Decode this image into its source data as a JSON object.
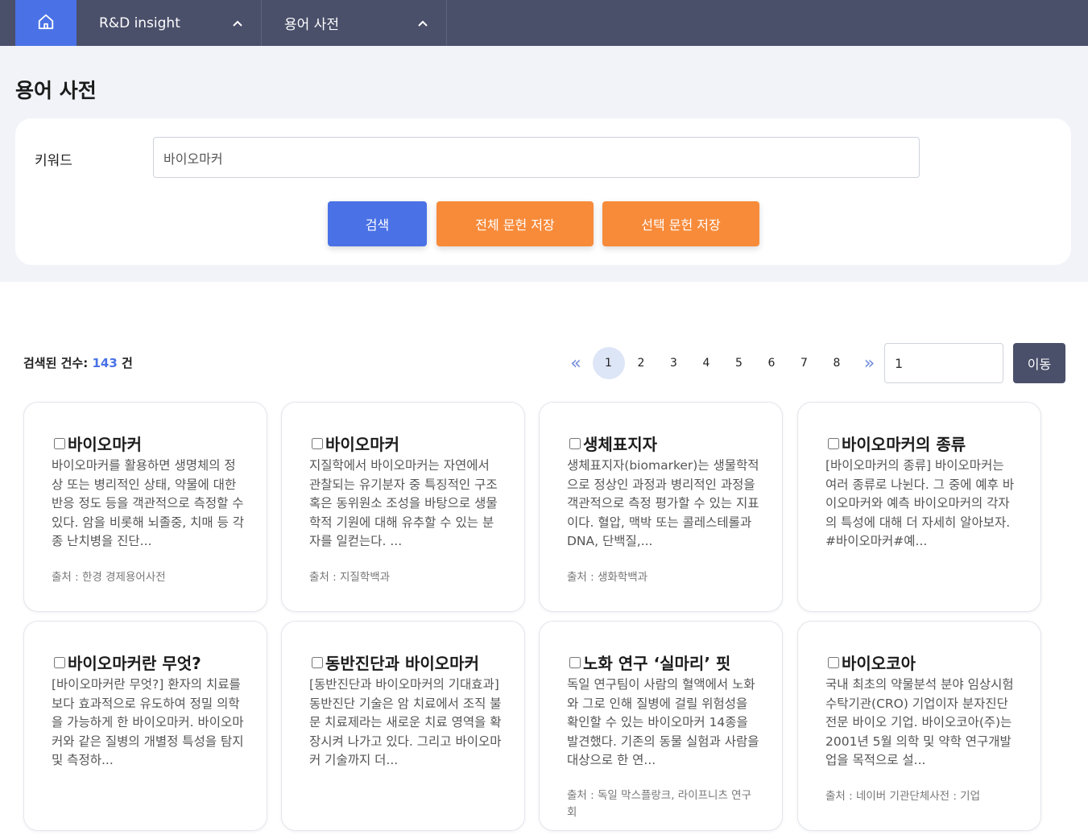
{
  "nav": {
    "items": [
      {
        "label": "R&D insight"
      },
      {
        "label": "용어 사전"
      }
    ]
  },
  "page": {
    "title": "용어 사전"
  },
  "search": {
    "keyword_label": "키워드",
    "keyword_value": "바이오마커",
    "search_button": "검색",
    "save_all_button": "전체 문헌 저장",
    "save_selected_button": "선택 문헌 저장"
  },
  "results": {
    "count_label": "검색된 건수:",
    "count_value": "143",
    "count_unit": "건"
  },
  "pagination": {
    "prev": "«",
    "next": "»",
    "pages": [
      "1",
      "2",
      "3",
      "4",
      "5",
      "6",
      "7",
      "8"
    ],
    "current": "1",
    "jump_value": "1",
    "go_button": "이동"
  },
  "cards": [
    {
      "title": "바이오마커",
      "body": "바이오마커를 활용하면 생명체의 정상 또는 병리적인 상태, 약물에 대한 반응 정도 등을 객관적으로 측정할 수 있다. 암을 비롯해 뇌졸중, 치매 등 각종 난치병을 진단...",
      "source": "출처 : 한경 경제용어사전"
    },
    {
      "title": "바이오마커",
      "body": "지질학에서 바이오마커는 자연에서 관찰되는 유기분자 중 특징적인 구조 혹은 동위원소 조성을 바탕으로 생물학적 기원에 대해 유추할 수 있는 분자를 일컫는다. ...",
      "source": "출처 : 지질학백과"
    },
    {
      "title": "생체표지자",
      "body": "생체표지자(biomarker)는 생물학적으로 정상인 과정과 병리적인 과정을 객관적으로 측정 평가할 수 있는 지표이다. 혈압, 맥박 또는 콜레스테롤과 DNA, 단백질,...",
      "source": "출처 : 생화학백과"
    },
    {
      "title": "바이오마커의 종류",
      "body": "[바이오마커의 종류] 바이오마커는 여러 종류로 나뉜다. 그 중에 예후 바이오마커와 예측 바이오마커의 각자의 특성에 대해 더 자세히 알아보자. #바이오마커#예...",
      "source": ""
    },
    {
      "title": "바이오마커란 무엇?",
      "body": "[바이오마커란 무엇?] 환자의 치료를 보다 효과적으로 유도하여 정밀 의학을 가능하게 한 바이오마커. 바이오마커와 같은 질병의 개별정 특성을 탐지 및 측정하...",
      "source": ""
    },
    {
      "title": "동반진단과 바이오마커",
      "body": "[동반진단과 바이오마커의 기대효과] 동반진단 기술은 암 치료에서 조직 불문 치료제라는 새로운 치료 영역을 확장시켜 나가고 있다. 그리고 바이오마커 기술까지 더...",
      "source": ""
    },
    {
      "title": "노화 연구 ‘실마리’ 핏",
      "body": "독일 연구팀이 사람의 혈액에서 노화와 그로 인해 질병에 걸릴 위험성을 확인할 수 있는 바이오마커 14종을 발견했다. 기존의 동물 실험과 사람을 대상으로 한 연...",
      "source": "출처 : 독일 막스플랑크, 라이프니츠 연구회"
    },
    {
      "title": "바이오코아",
      "body": "국내 최초의 약물분석 분야 임상시험수탁기관(CRO) 기업이자 분자진단 전문 바이오 기업. 바이오코아(주)는 2001년 5월 의학 및 약학 연구개발업을 목적으로 설...",
      "source": "출처 : 네이버 기관단체사전 : 기업"
    }
  ],
  "colors": {
    "nav_bg": "#4a4f6a",
    "primary": "#4a72e6",
    "accent": "#f78b3a",
    "search_bg": "#f1f3f8"
  }
}
